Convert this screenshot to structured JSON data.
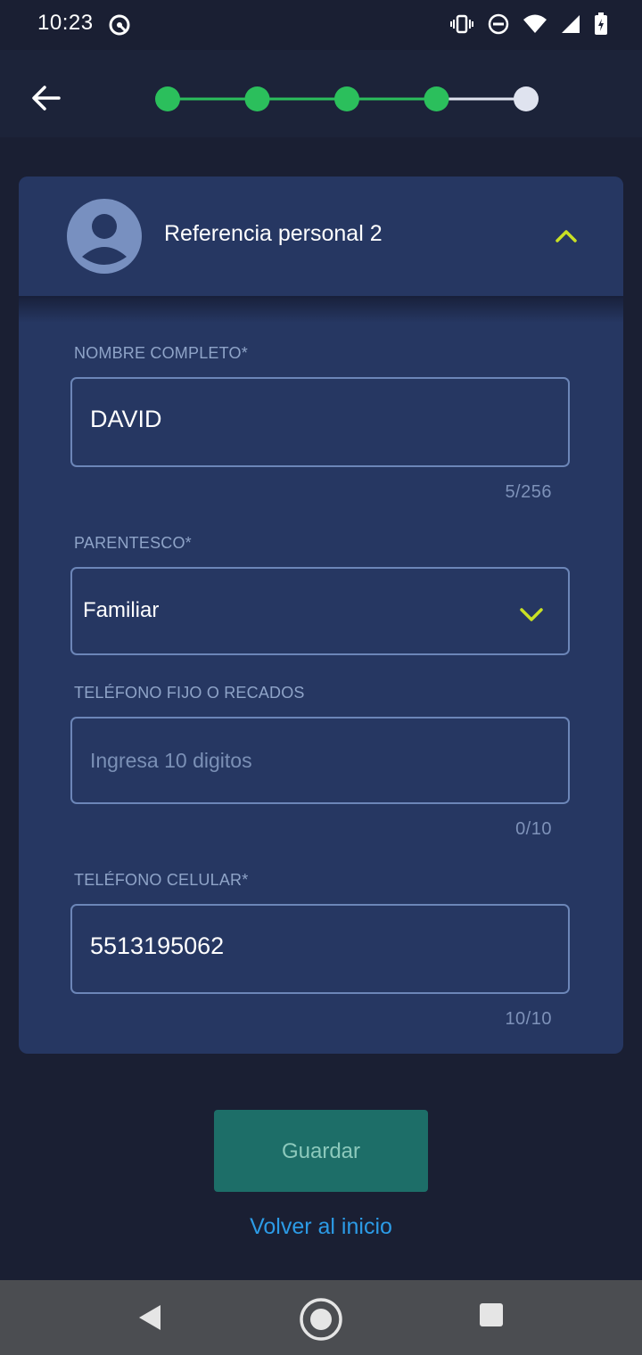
{
  "status_bar": {
    "time": "10:23",
    "icons": [
      "sync-icon",
      "vibrate-icon",
      "do-not-disturb-icon",
      "wifi-icon",
      "signal-icon",
      "battery-icon"
    ]
  },
  "header": {
    "back_icon": "arrow-left-icon",
    "stepper": {
      "total_steps": 5,
      "completed_steps": 4,
      "active_color": "#2bbf5c",
      "inactive_color": "#dfe3ef"
    }
  },
  "card": {
    "avatar_icon": "person-avatar-icon",
    "title": "Referencia personal 2",
    "collapse_icon": "chevron-up-icon",
    "accent_color": "#c9e024",
    "fields": {
      "nombre": {
        "label": "NOMBRE COMPLETO*",
        "value": "DAVID",
        "counter": "5/256"
      },
      "parentesco": {
        "label": "PARENTESCO*",
        "value": "Familiar",
        "dropdown_icon": "chevron-down-icon"
      },
      "telefono_fijo": {
        "label": "TELÉFONO FIJO O RECADOS",
        "placeholder": "Ingresa 10 digitos",
        "counter": "0/10"
      },
      "telefono_celular": {
        "label": "TELÉFONO CELULAR*",
        "value": "5513195062",
        "counter": "10/10"
      }
    }
  },
  "actions": {
    "save_label": "Guardar",
    "back_home_label": "Volver al inicio"
  },
  "nav_bar": {
    "icons": [
      "nav-back-icon",
      "nav-home-icon",
      "nav-recents-icon"
    ]
  }
}
